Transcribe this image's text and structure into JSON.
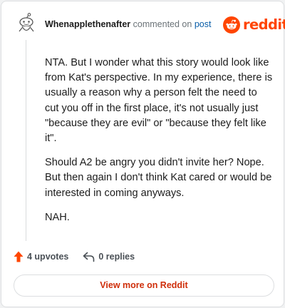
{
  "comment": {
    "username": "Whenapplethenafter",
    "action_text": "commented on",
    "post_link": "post",
    "paragraphs": [
      "NTA. But I wonder what this story would look like from Kat's perspective. In my experience, there is usually a reason why a person felt the need to cut you off in the first place, it's not usually just \"because they are evil\" or \"because they felt like it\".",
      "Should A2 be angry you didn't invite her? Nope. But then again I don't think Kat cared or would be interested in coming anyways.",
      "NAH."
    ]
  },
  "brand": {
    "wordmark": "reddit",
    "color": "#ff4500"
  },
  "actions": {
    "upvotes": "4 upvotes",
    "replies": "0 replies",
    "upvote_icon": "upvote-arrow-icon",
    "reply_icon": "reply-arrow-icon"
  },
  "footer": {
    "view_more_label": "View more on Reddit",
    "accent": "#cf2e0a"
  }
}
